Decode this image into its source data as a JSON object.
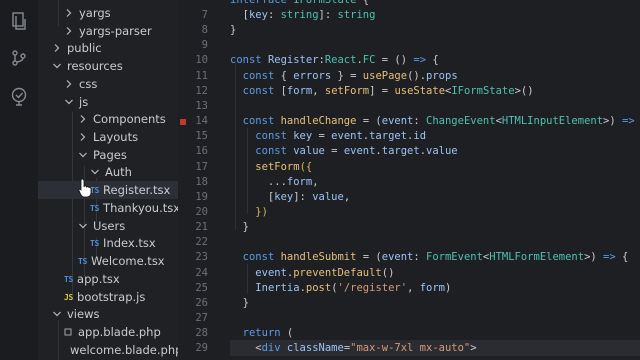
{
  "activity_icons": [
    "files-icon",
    "git-icon",
    "accounts-icon"
  ],
  "explorer": {
    "items": [
      {
        "label": "yargs",
        "kind": "folder",
        "state": "collapsed"
      },
      {
        "label": "yargs-parser",
        "kind": "folder",
        "state": "collapsed"
      },
      {
        "label": "public",
        "kind": "folder",
        "state": "collapsed"
      },
      {
        "label": "resources",
        "kind": "folder",
        "state": "expanded"
      },
      {
        "label": "css",
        "kind": "folder",
        "state": "collapsed"
      },
      {
        "label": "js",
        "kind": "folder",
        "state": "expanded"
      },
      {
        "label": "Components",
        "kind": "folder",
        "state": "collapsed"
      },
      {
        "label": "Layouts",
        "kind": "folder",
        "state": "collapsed"
      },
      {
        "label": "Pages",
        "kind": "folder",
        "state": "expanded"
      },
      {
        "label": "Auth",
        "kind": "folder",
        "state": "expanded"
      },
      {
        "label": "Register.tsx",
        "kind": "ts",
        "badge": "TS",
        "selected": true
      },
      {
        "label": "Thankyou.tsx",
        "kind": "ts",
        "badge": "TS"
      },
      {
        "label": "Users",
        "kind": "folder",
        "state": "expanded"
      },
      {
        "label": "Index.tsx",
        "kind": "ts",
        "badge": "TS"
      },
      {
        "label": "Welcome.tsx",
        "kind": "ts",
        "badge": "TS"
      },
      {
        "label": "app.tsx",
        "kind": "ts",
        "badge": "TS"
      },
      {
        "label": "bootstrap.js",
        "kind": "js",
        "badge": "JS"
      },
      {
        "label": "views",
        "kind": "folder",
        "state": "expanded"
      },
      {
        "label": "app.blade.php",
        "kind": "php"
      },
      {
        "label": "welcome.blade.php",
        "kind": "php"
      }
    ]
  },
  "editor": {
    "line_numbers": [
      "7",
      "8",
      "9",
      "10",
      "11",
      "12",
      "13",
      "14",
      "15",
      "16",
      "17",
      "18",
      "19",
      "20",
      "21",
      "22",
      "23",
      "24",
      "25",
      "26",
      "27",
      "28",
      "29"
    ],
    "breakpoint_line": "14",
    "lines": [
      [
        [
          "pn",
          "  ["
        ],
        [
          "vr",
          "key"
        ],
        [
          "pn",
          ": "
        ],
        [
          "ty",
          "string"
        ],
        [
          "pn",
          "]: "
        ],
        [
          "ty",
          "string"
        ]
      ],
      [
        [
          "pn",
          "}"
        ]
      ],
      [],
      [
        [
          "kw",
          "const "
        ],
        [
          "vr",
          "Register"
        ],
        [
          "pn",
          ":"
        ],
        [
          "ty",
          "React"
        ],
        [
          "pn",
          "."
        ],
        [
          "ty",
          "FC"
        ],
        [
          "pn",
          " = () "
        ],
        [
          "kw",
          "=>"
        ],
        [
          "pn",
          " {"
        ]
      ],
      [
        [
          "pn",
          "  "
        ],
        [
          "kw",
          "const "
        ],
        [
          "pn",
          "{ "
        ],
        [
          "vr",
          "errors"
        ],
        [
          "pn",
          " } = "
        ],
        [
          "fn",
          "usePage"
        ],
        [
          "pn",
          "()."
        ],
        [
          "vr",
          "props"
        ]
      ],
      [
        [
          "pn",
          "  "
        ],
        [
          "kw",
          "const "
        ],
        [
          "pn",
          "["
        ],
        [
          "vr",
          "form"
        ],
        [
          "pn",
          ", "
        ],
        [
          "fn",
          "setForm"
        ],
        [
          "pn",
          "] = "
        ],
        [
          "fn",
          "useState"
        ],
        [
          "pn",
          "<"
        ],
        [
          "ty",
          "IFormState"
        ],
        [
          "pn",
          ">()"
        ]
      ],
      [],
      [
        [
          "pn",
          "  "
        ],
        [
          "kw",
          "const "
        ],
        [
          "fn",
          "handleChange"
        ],
        [
          "pn",
          " = ("
        ],
        [
          "vr",
          "event"
        ],
        [
          "pn",
          ": "
        ],
        [
          "ty",
          "ChangeEvent"
        ],
        [
          "pn",
          "<"
        ],
        [
          "ty",
          "HTMLInputElement"
        ],
        [
          "pn",
          ">) "
        ],
        [
          "kw",
          "=>"
        ],
        [
          "pn",
          " {"
        ]
      ],
      [
        [
          "pn",
          "    "
        ],
        [
          "kw",
          "const "
        ],
        [
          "vr",
          "key"
        ],
        [
          "pn",
          " = "
        ],
        [
          "vr",
          "event"
        ],
        [
          "pn",
          "."
        ],
        [
          "vr",
          "target"
        ],
        [
          "pn",
          "."
        ],
        [
          "vr",
          "id"
        ]
      ],
      [
        [
          "pn",
          "    "
        ],
        [
          "kw",
          "const "
        ],
        [
          "vr",
          "value"
        ],
        [
          "pn",
          " = "
        ],
        [
          "vr",
          "event"
        ],
        [
          "pn",
          "."
        ],
        [
          "vr",
          "target"
        ],
        [
          "pn",
          "."
        ],
        [
          "vr",
          "value"
        ]
      ],
      [
        [
          "pn",
          "    "
        ],
        [
          "fn",
          "setForm"
        ],
        [
          "br",
          "({"
        ]
      ],
      [
        [
          "pn",
          "      ..."
        ],
        [
          "vr",
          "form"
        ],
        [
          "pn",
          ","
        ]
      ],
      [
        [
          "pn",
          "      ["
        ],
        [
          "vr",
          "key"
        ],
        [
          "pn",
          "]: "
        ],
        [
          "vr",
          "value"
        ],
        [
          "pn",
          ","
        ]
      ],
      [
        [
          "br",
          "    })"
        ]
      ],
      [
        [
          "pn",
          "  }"
        ]
      ],
      [],
      [
        [
          "pn",
          "  "
        ],
        [
          "kw",
          "const "
        ],
        [
          "fn",
          "handleSubmit"
        ],
        [
          "pn",
          " = ("
        ],
        [
          "vr",
          "event"
        ],
        [
          "pn",
          ": "
        ],
        [
          "ty",
          "FormEvent"
        ],
        [
          "pn",
          "<"
        ],
        [
          "ty",
          "HTMLFormElement"
        ],
        [
          "pn",
          ">) "
        ],
        [
          "kw",
          "=>"
        ],
        [
          "pn",
          " {"
        ]
      ],
      [
        [
          "pn",
          "    "
        ],
        [
          "vr",
          "event"
        ],
        [
          "pn",
          "."
        ],
        [
          "fn",
          "preventDefault"
        ],
        [
          "pn",
          "()"
        ]
      ],
      [
        [
          "pn",
          "    "
        ],
        [
          "vr",
          "Inertia"
        ],
        [
          "pn",
          "."
        ],
        [
          "fn",
          "post"
        ],
        [
          "pn",
          "("
        ],
        [
          "st",
          "'/register'"
        ],
        [
          "pn",
          ", "
        ],
        [
          "vr",
          "form"
        ],
        [
          "pn",
          ")"
        ]
      ],
      [
        [
          "pn",
          "  }"
        ]
      ],
      [],
      [
        [
          "pn",
          "  "
        ],
        [
          "kw",
          "return "
        ],
        [
          "pn",
          "("
        ]
      ],
      [
        [
          "pn",
          "    <"
        ],
        [
          "kw",
          "div "
        ],
        [
          "vr",
          "className"
        ],
        [
          "pn",
          "="
        ],
        [
          "st",
          "\"max-w-7xl mx-auto\""
        ],
        [
          "pn",
          ">"
        ]
      ]
    ],
    "partial_top_line": [
      [
        "kw",
        "interface "
      ],
      [
        "ty",
        "IFormState "
      ],
      [
        "pn",
        "{"
      ]
    ]
  },
  "colors": {
    "background": "#1e1f22",
    "sidebar": "#202124",
    "activity_bar": "#1b1c1f",
    "keyword": "#5c9ce6",
    "type": "#4fc1b0",
    "function": "#e5c07b",
    "variable": "#9cc3f5",
    "string": "#d69a7d",
    "breakpoint": "#c0392b"
  }
}
